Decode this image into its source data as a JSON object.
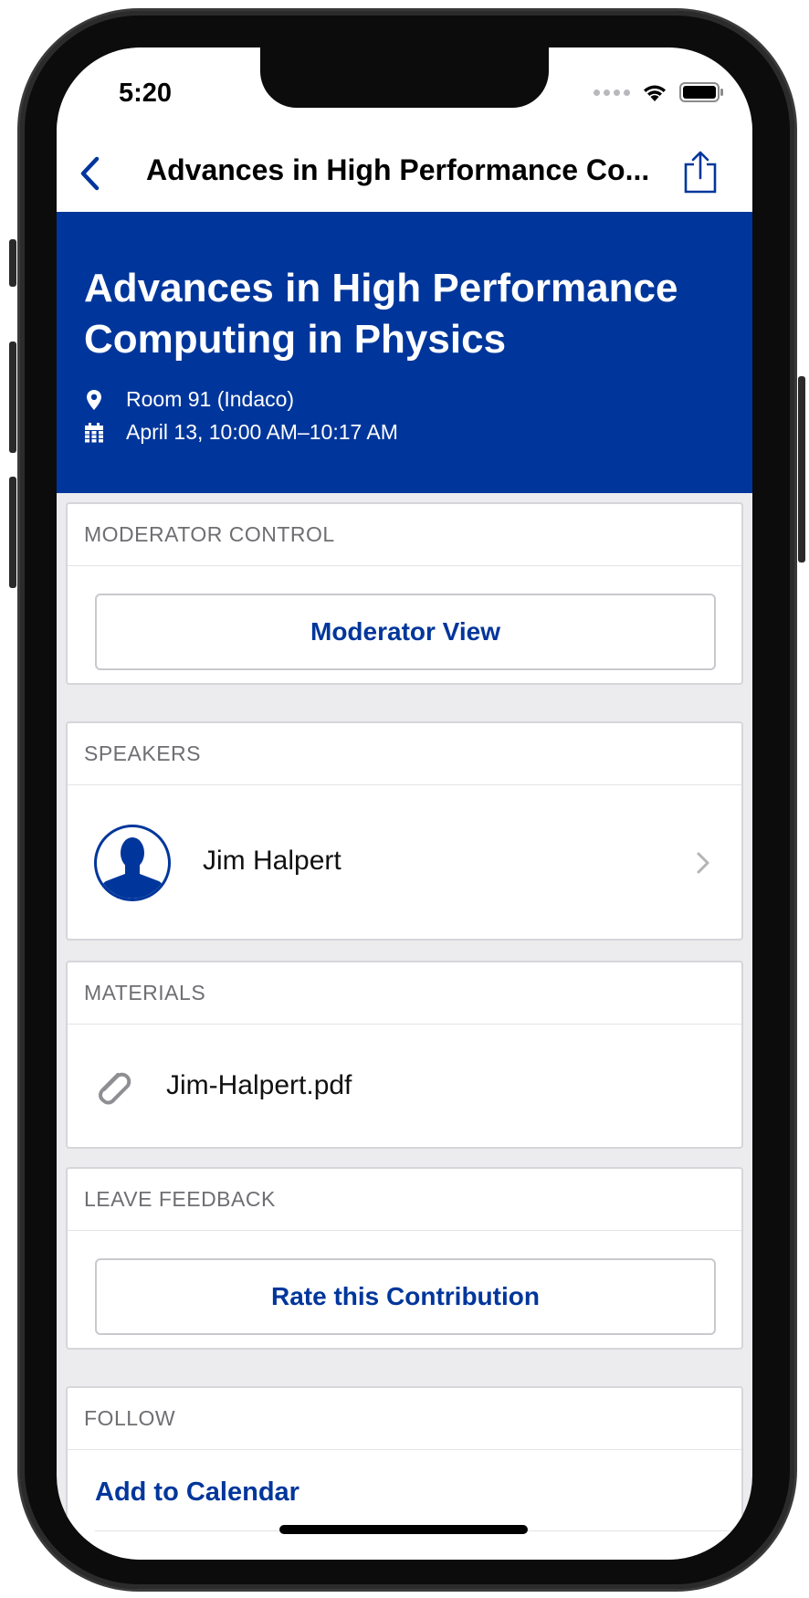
{
  "status_bar": {
    "time": "5:20"
  },
  "nav": {
    "title": "Advances in High Performance Co..."
  },
  "header": {
    "title_line1": "Advances in High Performance",
    "title_line2": "Computing in Physics",
    "location": "Room 91 (Indaco)",
    "datetime": "April 13, 10:00 AM–10:17 AM"
  },
  "moderator": {
    "section_title": "MODERATOR CONTROL",
    "button_label": "Moderator View"
  },
  "speakers": {
    "section_title": "SPEAKERS",
    "items": [
      {
        "name": "Jim Halpert"
      }
    ]
  },
  "materials": {
    "section_title": "MATERIALS",
    "items": [
      {
        "filename": "Jim-Halpert.pdf"
      }
    ]
  },
  "feedback": {
    "section_title": "LEAVE FEEDBACK",
    "button_label": "Rate this Contribution"
  },
  "follow": {
    "section_title": "FOLLOW",
    "add_to_calendar": "Add to Calendar"
  },
  "colors": {
    "brand_blue": "#00369b",
    "background": "#ececef",
    "section_label": "#6e6e73"
  },
  "icons": {
    "back": "chevron-left-icon",
    "share": "share-icon",
    "location": "map-pin-icon",
    "calendar": "calendar-icon",
    "speaker_avatar": "person-silhouette-icon",
    "disclosure": "chevron-right-icon",
    "attachment": "paperclip-icon"
  }
}
